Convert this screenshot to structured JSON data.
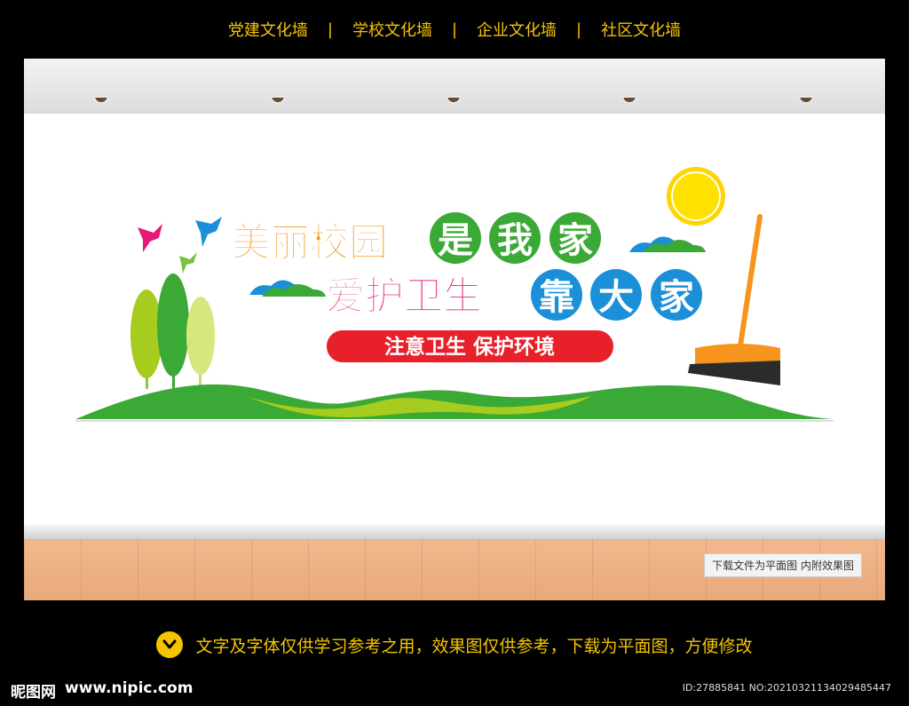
{
  "topnav": {
    "items": [
      "党建文化墙",
      "学校文化墙",
      "企业文化墙",
      "社区文化墙"
    ],
    "separator": "|"
  },
  "banner": {
    "line1_part1": "美丽校园",
    "line1_part2": [
      "是",
      "我",
      "家"
    ],
    "line2_part1": "爱护卫生",
    "line2_part2": [
      "靠",
      "大",
      "家"
    ],
    "slogan": "注意卫生  保护环境"
  },
  "note": "下载文件为平面图  内附效果图",
  "bottom": {
    "text": "文字及字体仅供学习参考之用，效果图仅供参考，下载为平面图，方便修改"
  },
  "footer": {
    "logo": "昵图网",
    "site": "www.nipic.com",
    "id": "ID:27885841 NO:20210321134029485447"
  },
  "colors": {
    "accent_yellow": "#f5c400",
    "orange": "#f7941d",
    "green": "#3aa935",
    "magenta": "#e4197a",
    "blue": "#1b8fd7",
    "red": "#e8202a"
  },
  "icons": [
    "chevron-down-icon",
    "bird-icon",
    "sun-icon",
    "cloud-icon",
    "tree-icon",
    "broom-icon"
  ]
}
